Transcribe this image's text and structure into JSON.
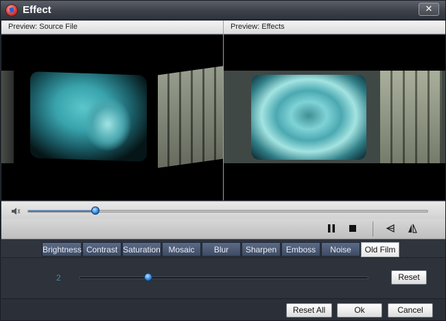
{
  "window": {
    "title": "Effect",
    "close_label": "✕"
  },
  "preview": {
    "source_label": "Preview: Source File",
    "effects_label": "Preview: Effects"
  },
  "playback": {
    "progress": 0.17
  },
  "tabs": [
    {
      "label": "Brightness",
      "active": false
    },
    {
      "label": "Contrast",
      "active": false
    },
    {
      "label": "Saturation",
      "active": false
    },
    {
      "label": "Mosaic",
      "active": false
    },
    {
      "label": "Blur",
      "active": false
    },
    {
      "label": "Sharpen",
      "active": false
    },
    {
      "label": "Emboss",
      "active": false
    },
    {
      "label": "Noise",
      "active": false
    },
    {
      "label": "Old Film",
      "active": true
    }
  ],
  "effect_level": {
    "value": "2",
    "fraction": 0.24,
    "reset_label": "Reset"
  },
  "footer": {
    "reset_all_label": "Reset All",
    "ok_label": "Ok",
    "cancel_label": "Cancel"
  },
  "colors": {
    "accent": "#2b7fd8",
    "tab_bg": "#4a5872",
    "window_bg": "#2b303a"
  }
}
